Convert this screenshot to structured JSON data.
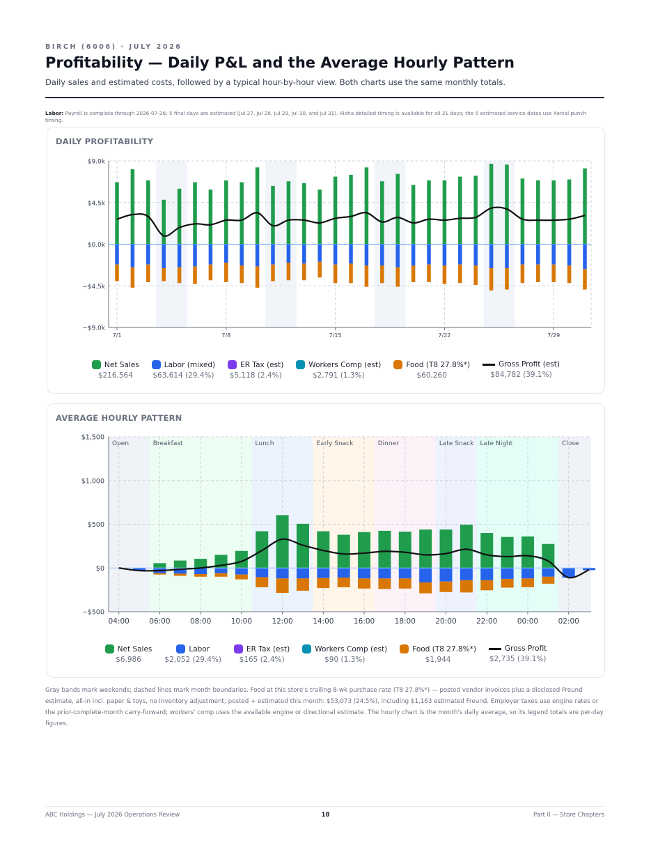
{
  "header": {
    "eyebrow": "BIRCH (6006) · JULY 2026",
    "title": "Profitability — Daily P&L and the Average Hourly Pattern",
    "subtitle": "Daily sales and estimated costs, followed by a typical hour-by-hour view. Both charts use the same monthly totals."
  },
  "labor_note": {
    "label": "Labor:",
    "text": "Payroll is complete through 2026-07-26; 5 final days are estimated (Jul 27, Jul 28, Jul 29, Jul 30, and Jul 31). Aloha detailed timing is available for all 31 days; the 5 estimated service dates use Xenial punch timing."
  },
  "colors": {
    "net_sales": "#1f9d4d",
    "labor": "#2563eb",
    "er_tax": "#7c3aed",
    "workers_comp": "#0891b2",
    "food": "#d97706",
    "gross_profit": "#111111"
  },
  "chart_data": [
    {
      "type": "bar",
      "title": "DAILY PROFITABILITY",
      "ylim": [
        -9000,
        9000
      ],
      "y_ticks": [
        -9000,
        -4500,
        0,
        4500,
        9000
      ],
      "y_tick_labels": [
        "−$9.0k",
        "−$4.5k",
        "$0.0k",
        "$4.5k",
        "$9.0k"
      ],
      "x_tick_labels": [
        {
          "day": 1,
          "label": "7/1"
        },
        {
          "day": 8,
          "label": "7/8"
        },
        {
          "day": 15,
          "label": "7/15"
        },
        {
          "day": 22,
          "label": "7/22"
        },
        {
          "day": 29,
          "label": "7/29"
        }
      ],
      "x": [
        1,
        2,
        3,
        4,
        5,
        6,
        7,
        8,
        9,
        10,
        11,
        12,
        13,
        14,
        15,
        16,
        17,
        18,
        19,
        20,
        21,
        22,
        23,
        24,
        25,
        26,
        27,
        28,
        29,
        30,
        31
      ],
      "weekend_days": [
        [
          4,
          5
        ],
        [
          11,
          12
        ],
        [
          18,
          19
        ],
        [
          25,
          26
        ]
      ],
      "series": [
        {
          "name": "Net Sales",
          "values": [
            6700,
            8100,
            6900,
            4800,
            6000,
            6700,
            5900,
            6900,
            6700,
            8300,
            6300,
            6800,
            6600,
            5900,
            7300,
            7500,
            8300,
            6800,
            7600,
            6400,
            6900,
            6900,
            7300,
            7400,
            8700,
            8600,
            7100,
            6900,
            6900,
            7000,
            8200
          ]
        },
        {
          "name": "Labor (mixed)",
          "values": [
            -2200,
            -2500,
            -2200,
            -2600,
            -2500,
            -2400,
            -2200,
            -2000,
            -2300,
            -2400,
            -2200,
            -2000,
            -2100,
            -1900,
            -2200,
            -2100,
            -2300,
            -2300,
            -2500,
            -2300,
            -2200,
            -2300,
            -2200,
            -2300,
            -2600,
            -2600,
            -2200,
            -2200,
            -2200,
            -2300,
            -2700
          ]
        },
        {
          "name": "Food (T8 27.8%*)",
          "values": [
            -1800,
            -2200,
            -1900,
            -1400,
            -1700,
            -1900,
            -1700,
            -2100,
            -1900,
            -2300,
            -1800,
            -1900,
            -1800,
            -1700,
            -2000,
            -2100,
            -2300,
            -1900,
            -2100,
            -1800,
            -1900,
            -2000,
            -2000,
            -2100,
            -2400,
            -2300,
            -2000,
            -1900,
            -1900,
            -1900,
            -2200
          ]
        },
        {
          "name": "Gross Profit (est)",
          "values": [
            2700,
            3200,
            3000,
            900,
            1800,
            2200,
            2100,
            2600,
            2600,
            3400,
            2000,
            2600,
            2600,
            2300,
            2800,
            3000,
            3400,
            2400,
            2900,
            2300,
            2700,
            2600,
            2800,
            2900,
            3900,
            3800,
            2700,
            2600,
            2600,
            2700,
            3100
          ]
        }
      ],
      "legend": [
        {
          "name": "Net Sales",
          "value": "$216,564",
          "color": "#1f9d4d"
        },
        {
          "name": "Labor (mixed)",
          "value": "$63,614 (29.4%)",
          "color": "#2563eb"
        },
        {
          "name": "ER Tax (est)",
          "value": "$5,118 (2.4%)",
          "color": "#7c3aed"
        },
        {
          "name": "Workers Comp (est)",
          "value": "$2,791 (1.3%)",
          "color": "#0891b2"
        },
        {
          "name": "Food (T8 27.8%*)",
          "value": "$60,260",
          "color": "#d97706"
        },
        {
          "name": "Gross Profit (est)",
          "value": "$84,782 (39.1%)",
          "color": "#111111",
          "line": true
        }
      ]
    },
    {
      "type": "bar",
      "title": "AVERAGE HOURLY PATTERN",
      "ylim": [
        -500,
        1500
      ],
      "y_ticks": [
        -500,
        0,
        500,
        1000,
        1500
      ],
      "y_tick_labels": [
        "−$500",
        "$0",
        "$500",
        "$1,000",
        "$1,500"
      ],
      "x_range": [
        3.5,
        27.1
      ],
      "x_tick_labels": [
        {
          "h": 4,
          "label": "04:00"
        },
        {
          "h": 6,
          "label": "06:00"
        },
        {
          "h": 8,
          "label": "08:00"
        },
        {
          "h": 10,
          "label": "10:00"
        },
        {
          "h": 12,
          "label": "12:00"
        },
        {
          "h": 14,
          "label": "14:00"
        },
        {
          "h": 16,
          "label": "16:00"
        },
        {
          "h": 18,
          "label": "18:00"
        },
        {
          "h": 20,
          "label": "20:00"
        },
        {
          "h": 22,
          "label": "22:00"
        },
        {
          "h": 24,
          "label": "00:00"
        },
        {
          "h": 26,
          "label": "02:00"
        }
      ],
      "dayparts": [
        {
          "name": "Open",
          "start": 3.5,
          "end": 5.5,
          "color": "#e2e8f0"
        },
        {
          "name": "Breakfast",
          "start": 5.5,
          "end": 10.5,
          "color": "#dcfce7"
        },
        {
          "name": "Lunch",
          "start": 10.5,
          "end": 13.5,
          "color": "#dbeafe"
        },
        {
          "name": "Early Snack",
          "start": 13.5,
          "end": 16.5,
          "color": "#ffedd5"
        },
        {
          "name": "Dinner",
          "start": 16.5,
          "end": 19.5,
          "color": "#fce7f3"
        },
        {
          "name": "Late Snack",
          "start": 19.5,
          "end": 21.5,
          "color": "#e0e7ff"
        },
        {
          "name": "Late Night",
          "start": 21.5,
          "end": 25.5,
          "color": "#ccfbf1"
        },
        {
          "name": "Close",
          "start": 25.5,
          "end": 27.1,
          "color": "#e2e8f0"
        }
      ],
      "x": [
        4,
        5,
        6,
        7,
        8,
        9,
        10,
        11,
        12,
        13,
        14,
        15,
        16,
        17,
        18,
        19,
        20,
        21,
        22,
        23,
        24,
        25,
        26,
        27
      ],
      "series": [
        {
          "name": "Net Sales",
          "values": [
            0,
            0,
            55,
            85,
            105,
            150,
            195,
            420,
            605,
            505,
            420,
            380,
            410,
            425,
            415,
            440,
            440,
            495,
            400,
            355,
            360,
            275,
            0,
            0
          ]
        },
        {
          "name": "Labor",
          "values": [
            0,
            -25,
            -60,
            -65,
            -70,
            -60,
            -75,
            -105,
            -120,
            -120,
            -115,
            -110,
            -120,
            -120,
            -120,
            -165,
            -155,
            -140,
            -140,
            -125,
            -120,
            -100,
            -110,
            -25
          ]
        },
        {
          "name": "Food (T8 27.8%*)",
          "values": [
            0,
            0,
            -15,
            -25,
            -30,
            -40,
            -55,
            -115,
            -165,
            -140,
            -115,
            -110,
            -115,
            -120,
            -115,
            -125,
            -120,
            -140,
            -115,
            -100,
            -100,
            -80,
            0,
            0
          ]
        },
        {
          "name": "Gross Profit",
          "values": [
            0,
            -30,
            -30,
            -15,
            0,
            30,
            75,
            200,
            330,
            260,
            200,
            160,
            170,
            190,
            180,
            150,
            165,
            215,
            150,
            130,
            140,
            80,
            -110,
            -20
          ]
        }
      ],
      "legend": [
        {
          "name": "Net Sales",
          "value": "$6,986",
          "color": "#1f9d4d"
        },
        {
          "name": "Labor",
          "value": "$2,052 (29.4%)",
          "color": "#2563eb"
        },
        {
          "name": "ER Tax (est)",
          "value": "$165 (2.4%)",
          "color": "#7c3aed"
        },
        {
          "name": "Workers Comp (est)",
          "value": "$90 (1.3%)",
          "color": "#0891b2"
        },
        {
          "name": "Food (T8 27.8%*)",
          "value": "$1,944",
          "color": "#d97706"
        },
        {
          "name": "Gross Profit",
          "value": "$2,735 (39.1%)",
          "color": "#111111",
          "line": true
        }
      ]
    }
  ],
  "footnote": "Gray bands mark weekends; dashed lines mark month boundaries. Food at this store's trailing 8-wk purchase rate (T8 27.8%*) — posted vendor invoices plus a disclosed Freund estimate, all-in incl. paper & toys, no inventory adjustment; posted + estimated this month: $53,073 (24.5%), including $1,163 estimated Freund. Employer taxes use engine rates or the prior-complete-month carry-forward; workers' comp uses the available engine or directional estimate. The hourly chart is the month's daily average, so its legend totals are per-day figures.",
  "footer": {
    "left": "ABC Holdings — July 2026 Operations Review",
    "page": "18",
    "right": "Part II — Store Chapters"
  }
}
